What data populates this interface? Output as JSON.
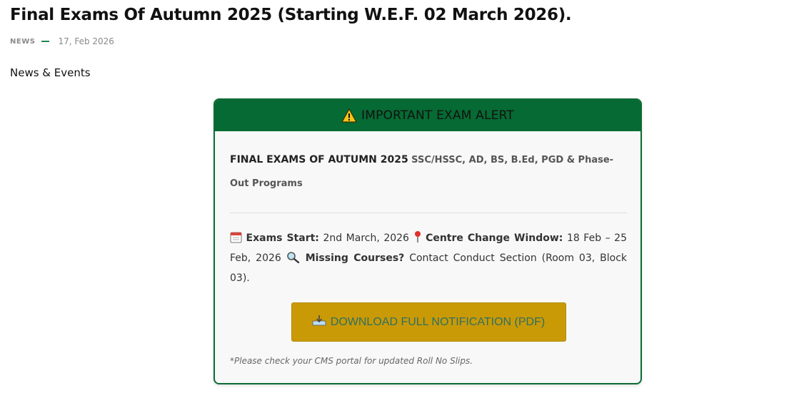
{
  "post": {
    "title": "Final Exams Of Autumn 2025 (Starting W.E.F. 02 March 2026).",
    "category": "NEWS",
    "date": "17, Feb 2026",
    "section_label": "News & Events"
  },
  "alert": {
    "header_icon": "warning-icon",
    "header_text": "IMPORTANT EXAM ALERT",
    "programs_lead": "FINAL EXAMS OF AUTUMN 2025",
    "programs_rest": "SSC/HSSC, AD, BS, B.Ed, PGD & Phase-Out Programs",
    "exams_start_icon": "calendar-icon",
    "exams_start_label": "Exams Start:",
    "exams_start_value": "2nd March, 2026",
    "centre_change_icon": "pin-icon",
    "centre_change_label": "Centre Change Window:",
    "centre_change_value": "18 Feb – 25 Feb, 2026",
    "missing_courses_icon": "magnifier-icon",
    "missing_courses_label": "Missing Courses?",
    "missing_courses_value": "Contact Conduct Section (Room 03, Block 03).",
    "download_icon": "download-tray-icon",
    "download_label": "DOWNLOAD FULL NOTIFICATION (PDF)",
    "note": "*Please check your CMS portal for updated Roll No Slips."
  },
  "colors": {
    "header_green": "#056a33",
    "border_green": "#0b6b34",
    "button_gold": "#c99a06",
    "button_text": "#2f6f63",
    "meta_dash": "#1a8a5a"
  }
}
